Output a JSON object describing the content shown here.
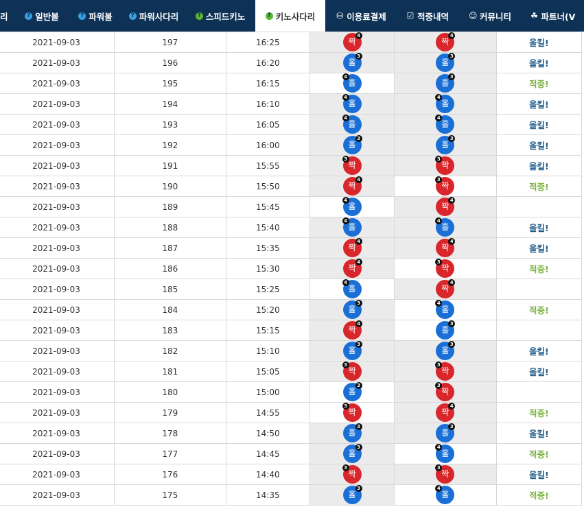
{
  "nav": {
    "tabs": [
      {
        "label": "리",
        "icon": "none",
        "w": 22
      },
      {
        "label": "일반볼",
        "icon": "question-icon",
        "w": 78
      },
      {
        "label": "파워볼",
        "icon": "question-icon",
        "w": 78
      },
      {
        "label": "파워사다리",
        "icon": "question-icon",
        "w": 92
      },
      {
        "label": "스피드키노",
        "icon": "question-green-icon",
        "w": 102
      },
      {
        "label": "키노사다리",
        "icon": "question-green-icon",
        "w": 102,
        "active": true
      },
      {
        "label": "이용료결제",
        "icon": "coins-icon",
        "w": 104
      },
      {
        "label": "적중내역",
        "icon": "check-icon",
        "w": 90
      },
      {
        "label": "커뮤니티",
        "icon": "smile-icon",
        "w": 92
      },
      {
        "label": "파트너(V",
        "icon": "partners-icon",
        "w": 91
      }
    ]
  },
  "colors": {
    "odd": "#1a6fd6",
    "even": "#d9262b",
    "allkill": "#1f5b8a",
    "hit": "#7cb342",
    "nav_bg": "#0e3156"
  },
  "rows": [
    {
      "date": "2021-09-03",
      "round": "197",
      "time": "16:25",
      "b1": {
        "t": "짝",
        "n": "4",
        "c": "even"
      },
      "b2": {
        "t": "짝",
        "n": "4",
        "c": "even"
      },
      "hl": [
        1,
        1
      ],
      "result": "올킬!",
      "rc": "allkill"
    },
    {
      "date": "2021-09-03",
      "round": "196",
      "time": "16:20",
      "b1": {
        "t": "홀",
        "n": "3",
        "c": "odd"
      },
      "b2": {
        "t": "홀",
        "n": "3",
        "c": "odd"
      },
      "hl": [
        1,
        1
      ],
      "result": "올킬!",
      "rc": "allkill"
    },
    {
      "date": "2021-09-03",
      "round": "195",
      "time": "16:15",
      "b1": {
        "t": "홀",
        "n": "4",
        "c": "odd"
      },
      "b2": {
        "t": "홀",
        "n": "3",
        "c": "odd"
      },
      "hl": [
        0,
        1
      ],
      "result": "적중!",
      "rc": "hit"
    },
    {
      "date": "2021-09-03",
      "round": "194",
      "time": "16:10",
      "b1": {
        "t": "홀",
        "n": "4",
        "c": "odd"
      },
      "b2": {
        "t": "홀",
        "n": "4",
        "c": "odd"
      },
      "hl": [
        1,
        1
      ],
      "result": "올킬!",
      "rc": "allkill"
    },
    {
      "date": "2021-09-03",
      "round": "193",
      "time": "16:05",
      "b1": {
        "t": "홀",
        "n": "4",
        "c": "odd"
      },
      "b2": {
        "t": "홀",
        "n": "4",
        "c": "odd"
      },
      "hl": [
        1,
        1
      ],
      "result": "올킬!",
      "rc": "allkill"
    },
    {
      "date": "2021-09-03",
      "round": "192",
      "time": "16:00",
      "b1": {
        "t": "홀",
        "n": "3",
        "c": "odd"
      },
      "b2": {
        "t": "홀",
        "n": "3",
        "c": "odd"
      },
      "hl": [
        1,
        1
      ],
      "result": "올킬!",
      "rc": "allkill"
    },
    {
      "date": "2021-09-03",
      "round": "191",
      "time": "15:55",
      "b1": {
        "t": "짝",
        "n": "3",
        "c": "even"
      },
      "b2": {
        "t": "짝",
        "n": "3",
        "c": "even"
      },
      "hl": [
        1,
        1
      ],
      "result": "올킬!",
      "rc": "allkill"
    },
    {
      "date": "2021-09-03",
      "round": "190",
      "time": "15:50",
      "b1": {
        "t": "짝",
        "n": "4",
        "c": "even"
      },
      "b2": {
        "t": "짝",
        "n": "3",
        "c": "even"
      },
      "hl": [
        1,
        0
      ],
      "result": "적중!",
      "rc": "hit"
    },
    {
      "date": "2021-09-03",
      "round": "189",
      "time": "15:45",
      "b1": {
        "t": "홀",
        "n": "4",
        "c": "odd"
      },
      "b2": {
        "t": "짝",
        "n": "4",
        "c": "even"
      },
      "hl": [
        0,
        1
      ],
      "result": "",
      "rc": "hit"
    },
    {
      "date": "2021-09-03",
      "round": "188",
      "time": "15:40",
      "b1": {
        "t": "홀",
        "n": "4",
        "c": "odd"
      },
      "b2": {
        "t": "홀",
        "n": "4",
        "c": "odd"
      },
      "hl": [
        1,
        1
      ],
      "result": "올킬!",
      "rc": "allkill"
    },
    {
      "date": "2021-09-03",
      "round": "187",
      "time": "15:35",
      "b1": {
        "t": "짝",
        "n": "4",
        "c": "even"
      },
      "b2": {
        "t": "짝",
        "n": "4",
        "c": "even"
      },
      "hl": [
        1,
        1
      ],
      "result": "올킬!",
      "rc": "allkill"
    },
    {
      "date": "2021-09-03",
      "round": "186",
      "time": "15:30",
      "b1": {
        "t": "짝",
        "n": "4",
        "c": "even"
      },
      "b2": {
        "t": "짝",
        "n": "3",
        "c": "even"
      },
      "hl": [
        1,
        0
      ],
      "result": "적중!",
      "rc": "hit"
    },
    {
      "date": "2021-09-03",
      "round": "185",
      "time": "15:25",
      "b1": {
        "t": "홀",
        "n": "4",
        "c": "odd"
      },
      "b2": {
        "t": "짝",
        "n": "4",
        "c": "even"
      },
      "hl": [
        0,
        1
      ],
      "result": "",
      "rc": "hit"
    },
    {
      "date": "2021-09-03",
      "round": "184",
      "time": "15:20",
      "b1": {
        "t": "홀",
        "n": "3",
        "c": "odd"
      },
      "b2": {
        "t": "홀",
        "n": "4",
        "c": "odd"
      },
      "hl": [
        1,
        0
      ],
      "result": "적중!",
      "rc": "hit"
    },
    {
      "date": "2021-09-03",
      "round": "183",
      "time": "15:15",
      "b1": {
        "t": "짝",
        "n": "4",
        "c": "even"
      },
      "b2": {
        "t": "홀",
        "n": "3",
        "c": "odd"
      },
      "hl": [
        1,
        0
      ],
      "result": "",
      "rc": "hit"
    },
    {
      "date": "2021-09-03",
      "round": "182",
      "time": "15:10",
      "b1": {
        "t": "홀",
        "n": "3",
        "c": "odd"
      },
      "b2": {
        "t": "홀",
        "n": "3",
        "c": "odd"
      },
      "hl": [
        1,
        1
      ],
      "result": "올킬!",
      "rc": "allkill"
    },
    {
      "date": "2021-09-03",
      "round": "181",
      "time": "15:05",
      "b1": {
        "t": "짝",
        "n": "3",
        "c": "even"
      },
      "b2": {
        "t": "짝",
        "n": "3",
        "c": "even"
      },
      "hl": [
        1,
        1
      ],
      "result": "올킬!",
      "rc": "allkill"
    },
    {
      "date": "2021-09-03",
      "round": "180",
      "time": "15:00",
      "b1": {
        "t": "홀",
        "n": "3",
        "c": "odd"
      },
      "b2": {
        "t": "짝",
        "n": "3",
        "c": "even"
      },
      "hl": [
        0,
        1
      ],
      "result": "",
      "rc": "hit"
    },
    {
      "date": "2021-09-03",
      "round": "179",
      "time": "14:55",
      "b1": {
        "t": "짝",
        "n": "3",
        "c": "even"
      },
      "b2": {
        "t": "짝",
        "n": "4",
        "c": "even"
      },
      "hl": [
        0,
        1
      ],
      "result": "적중!",
      "rc": "hit"
    },
    {
      "date": "2021-09-03",
      "round": "178",
      "time": "14:50",
      "b1": {
        "t": "홀",
        "n": "3",
        "c": "odd"
      },
      "b2": {
        "t": "홀",
        "n": "3",
        "c": "odd"
      },
      "hl": [
        1,
        1
      ],
      "result": "올킬!",
      "rc": "allkill"
    },
    {
      "date": "2021-09-03",
      "round": "177",
      "time": "14:45",
      "b1": {
        "t": "홀",
        "n": "3",
        "c": "odd"
      },
      "b2": {
        "t": "홀",
        "n": "4",
        "c": "odd"
      },
      "hl": [
        1,
        0
      ],
      "result": "적중!",
      "rc": "hit"
    },
    {
      "date": "2021-09-03",
      "round": "176",
      "time": "14:40",
      "b1": {
        "t": "짝",
        "n": "3",
        "c": "even"
      },
      "b2": {
        "t": "짝",
        "n": "3",
        "c": "even"
      },
      "hl": [
        1,
        1
      ],
      "result": "올킬!",
      "rc": "allkill"
    },
    {
      "date": "2021-09-03",
      "round": "175",
      "time": "14:35",
      "b1": {
        "t": "홀",
        "n": "3",
        "c": "odd"
      },
      "b2": {
        "t": "홀",
        "n": "4",
        "c": "odd"
      },
      "hl": [
        1,
        0
      ],
      "result": "적중!",
      "rc": "hit"
    }
  ]
}
